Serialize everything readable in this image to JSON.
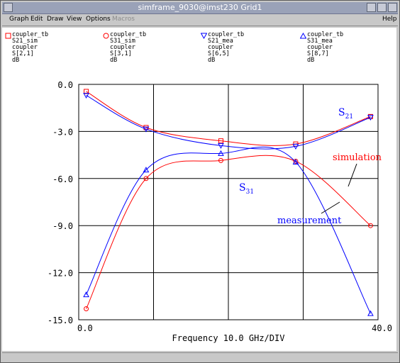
{
  "window": {
    "title": "simframe_9030@imst230 Grid1"
  },
  "menu": {
    "items": [
      "Graph",
      "Edit",
      "Draw",
      "View",
      "Options",
      "Macros"
    ],
    "help": "Help"
  },
  "legend": [
    {
      "name": "coupler_tb",
      "line2": "S21_sim",
      "line3": "coupler",
      "line4": "S[2,1]",
      "line5": "dB",
      "color": "#ff0000",
      "marker": "square"
    },
    {
      "name": "coupler_tb",
      "line2": "S31_sim",
      "line3": "coupler",
      "line4": "S[3,1]",
      "line5": "dB",
      "color": "#ff0000",
      "marker": "circle"
    },
    {
      "name": "coupler_tb",
      "line2": "S21_mea",
      "line3": "coupler",
      "line4": "S[6,5]",
      "line5": "dB",
      "color": "#0000ff",
      "marker": "triangle-down"
    },
    {
      "name": "coupler_tb",
      "line2": "S31_mea",
      "line3": "coupler",
      "line4": "S[8,7]",
      "line5": "dB",
      "color": "#0000ff",
      "marker": "triangle-up"
    }
  ],
  "chart_data": {
    "type": "line",
    "xlabel": "Frequency 10.0 GHz/DIV",
    "xlim": [
      0,
      40
    ],
    "ylim": [
      -15,
      0
    ],
    "x_ticks": [
      "0.0",
      "40.0"
    ],
    "y_ticks": [
      "0.0",
      "-3.0",
      "-6.0",
      "-9.0",
      "-12.0",
      "-15.0"
    ],
    "grid": true,
    "annotations": [
      {
        "text": "S",
        "sub": "21",
        "color": "#0000ff"
      },
      {
        "text": "S",
        "sub": "31",
        "color": "#0000ff"
      },
      {
        "text": "simulation",
        "color": "#ff0000"
      },
      {
        "text": "measurement",
        "color": "#0000ff"
      }
    ],
    "series": [
      {
        "name": "S21_sim",
        "color": "#ff0000",
        "marker": "square",
        "x": [
          1,
          9,
          19,
          29,
          39
        ],
        "y": [
          -0.45,
          -2.75,
          -3.6,
          -3.8,
          -2.05
        ]
      },
      {
        "name": "S31_sim",
        "color": "#ff0000",
        "marker": "circle",
        "x": [
          1,
          9,
          19,
          29,
          39
        ],
        "y": [
          -14.3,
          -6.0,
          -4.85,
          -4.9,
          -9.0
        ]
      },
      {
        "name": "S21_mea",
        "color": "#0000ff",
        "marker": "triangle-down",
        "x": [
          1,
          9,
          19,
          29,
          39
        ],
        "y": [
          -0.7,
          -2.85,
          -3.9,
          -3.95,
          -2.1
        ]
      },
      {
        "name": "S31_mea",
        "color": "#0000ff",
        "marker": "triangle-up",
        "x": [
          1,
          9,
          19,
          29,
          39
        ],
        "y": [
          -13.4,
          -5.45,
          -4.4,
          -4.95,
          -14.6
        ]
      }
    ]
  }
}
